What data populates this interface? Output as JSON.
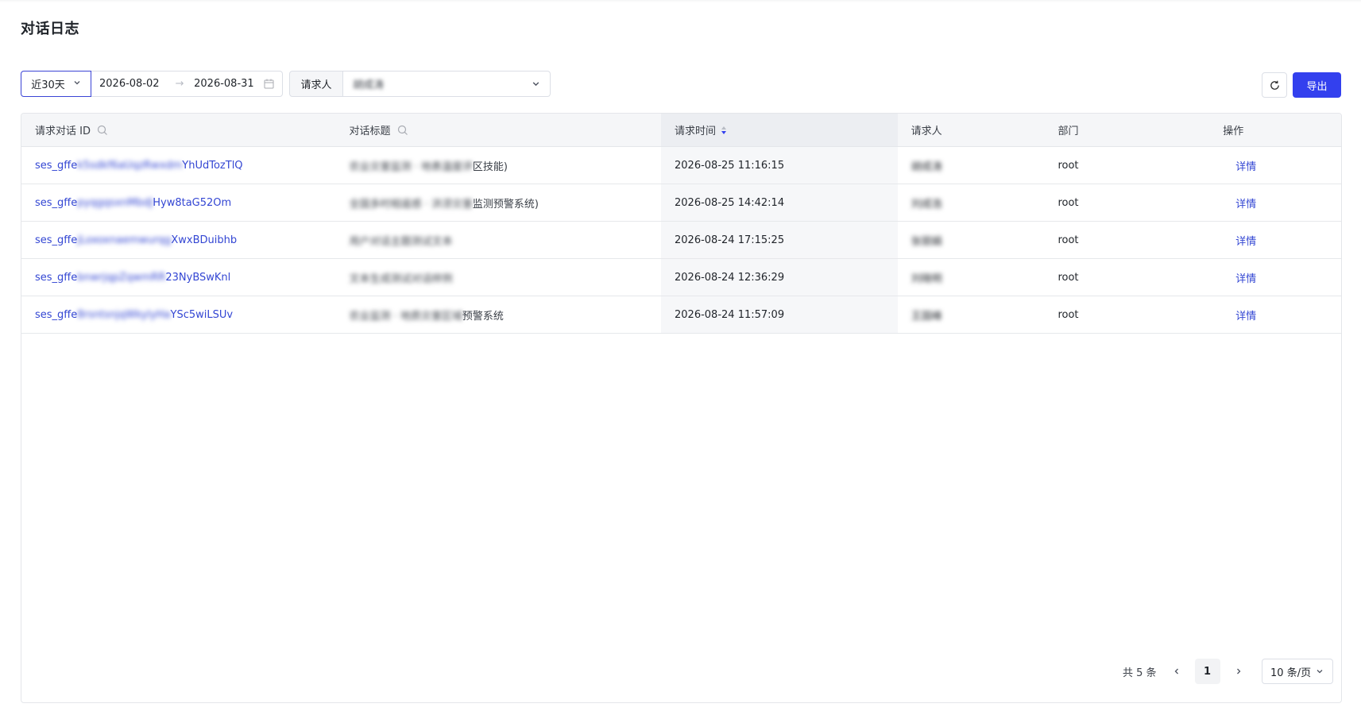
{
  "page": {
    "title": "对话日志"
  },
  "filters": {
    "range_option": "近30天",
    "start_date": "2026-08-02",
    "end_date": "2026-08-31",
    "date_separator": "→",
    "requester_label": "请求人",
    "requester_value": "胡成涛"
  },
  "actions": {
    "export_label": "导出"
  },
  "table": {
    "columns": [
      "请求对话 ID",
      "对话标题",
      "请求时间",
      "请求人",
      "部门",
      "操作"
    ],
    "rows": [
      {
        "id_prefix": "ses_gffe",
        "id_hidden": "k5sdkf6aUqzRwxdm",
        "id_suffix": "YhUdTozTlQ",
        "title_hidden": "农业灾害监测 · 地表温度评",
        "title_visible": "区技能)",
        "time": "2026-08-25 11:16:15",
        "requester": "胡成涛",
        "dept": "root",
        "action": "详情"
      },
      {
        "id_prefix": "ses_gffe",
        "id_hidden": "pyqgqsxnMbdJ",
        "id_suffix": "Hyw8taG52Om",
        "title_hidden": "全国多时相遥感 · 洪涝灾害",
        "title_visible": "监测预警系统)",
        "time": "2026-08-25 14:42:14",
        "requester": "刘成浩",
        "dept": "root",
        "action": "详情"
      },
      {
        "id_prefix": "ses_gffe",
        "id_hidden": "jLoxoxnaemwurqg",
        "id_suffix": "XwxBDuibhb",
        "title_hidden": "用户对话主题测试文本",
        "title_visible": "",
        "time": "2026-08-24 17:15:25",
        "requester": "张丽娟",
        "dept": "root",
        "action": "详情"
      },
      {
        "id_prefix": "ses_gffe",
        "id_hidden": "bnwrjqpZqwmRR",
        "id_suffix": "23NyBSwKnl",
        "title_hidden": "文本生成测试对话样例",
        "title_visible": "",
        "time": "2026-08-24 12:36:29",
        "requester": "刘晓明",
        "dept": "root",
        "action": "详情"
      },
      {
        "id_prefix": "ses_gffe",
        "id_hidden": "8rsntsnjqWkylyHa",
        "id_suffix": "YSc5wiLSUv",
        "title_hidden": "农业监测 · 地质灾害区域",
        "title_visible": "预警系统",
        "time": "2026-08-24 11:57:09",
        "requester": "王国峰",
        "dept": "root",
        "action": "详情"
      }
    ]
  },
  "pagination": {
    "total_text": "共 5 条",
    "current_page": "1",
    "page_size": "10 条/页"
  },
  "colors": {
    "primary": "#3340ee",
    "link": "#3346d3",
    "sort_active": "#3340ee"
  },
  "icons": [
    "chevron-down-icon",
    "arrow-right-icon",
    "calendar-icon",
    "refresh-icon",
    "search-icon",
    "sort-icon",
    "chevron-left-icon",
    "chevron-right-icon"
  ]
}
